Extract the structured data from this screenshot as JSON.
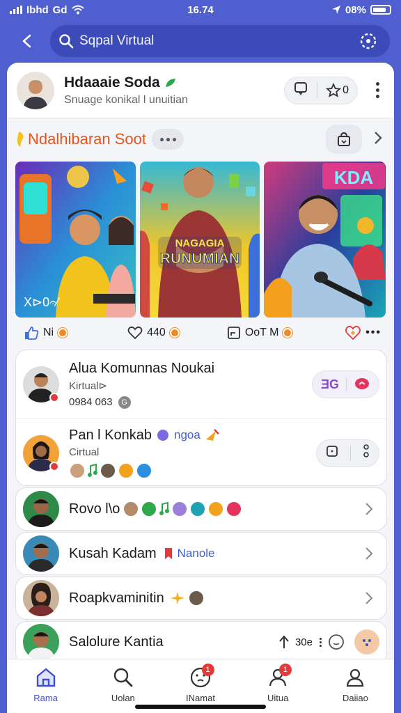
{
  "status": {
    "carrier": "Ibhd",
    "network": "Gd",
    "time": "16.74",
    "battery": "08%"
  },
  "header": {
    "search_text": "Sqpal Virtual"
  },
  "profile": {
    "name": "Hdaaaie Soda",
    "subtitle": "Snuage konikal l unuitian",
    "star_count": "0"
  },
  "section": {
    "title": "Ndalhibaran Soot"
  },
  "gallery": {
    "thumb1_caption": "X⊳0𝄐⁄",
    "thumb2_banner": [
      "NAGAGIA",
      "RUNUMIAN"
    ],
    "thumb3_sign": "KDA"
  },
  "reactions": {
    "likes": "Ni",
    "hearts": "440",
    "shares": "OoT M"
  },
  "list": [
    {
      "title": "Alua Komunnas Noukai",
      "sub": "Kirtual⊳",
      "meta": "0984 063",
      "badge_text": "ƎG"
    },
    {
      "title": "Pan l Konkab",
      "inline": "ngoa",
      "sub": "Cirtual"
    },
    {
      "title": "Rovo l\\o"
    },
    {
      "title": "Kusah Kadam",
      "tag": "Nanole"
    },
    {
      "title": "Roapkvaminitin"
    },
    {
      "title": "Salolure Kantia",
      "count": "30e"
    }
  ],
  "tabs": [
    {
      "label": "Rama",
      "badge": ""
    },
    {
      "label": "Uolan",
      "badge": ""
    },
    {
      "label": "INamat",
      "badge": "1"
    },
    {
      "label": "Uitua",
      "badge": "1"
    },
    {
      "label": "Daiiao",
      "badge": ""
    }
  ],
  "colors": {
    "brand": "#4f5fd0",
    "accent_orange": "#e5541f",
    "badge_red": "#e23b3b"
  }
}
